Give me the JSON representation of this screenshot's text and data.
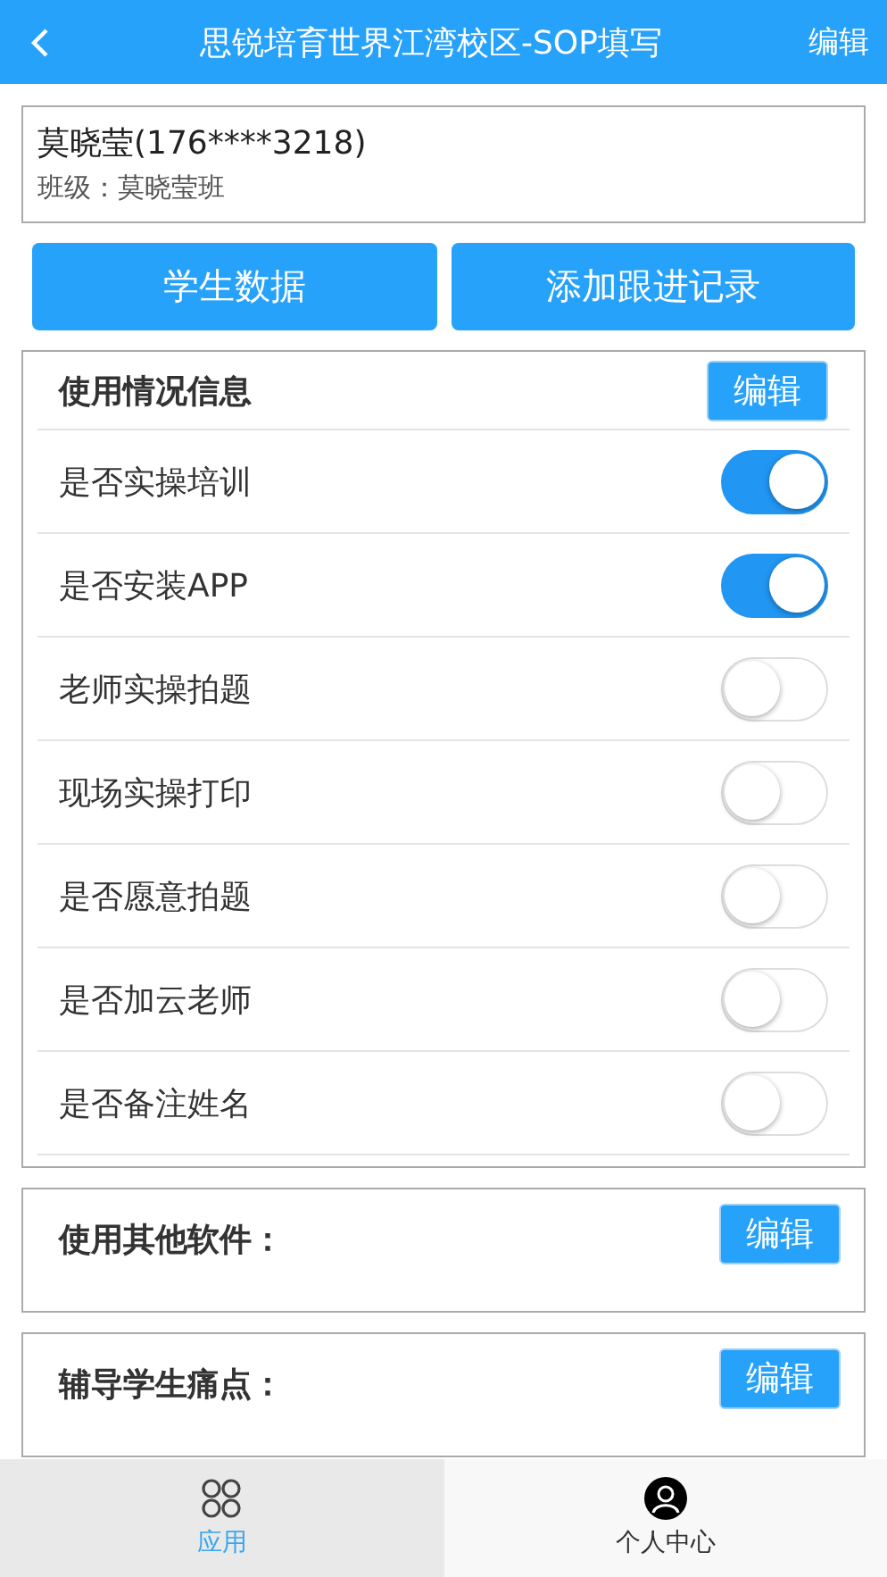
{
  "header": {
    "title": "思锐培育世界江湾校区-SOP填写",
    "action": "编辑"
  },
  "student": {
    "name": "莫晓莹(176****3218)",
    "class_line": "班级：莫晓莹班"
  },
  "action_buttons": [
    "学生数据",
    "添加跟进记录"
  ],
  "usage_panel": {
    "title": "使用情况信息",
    "edit_button": "编辑",
    "items": [
      {
        "label": "是否实操培训",
        "on": true
      },
      {
        "label": "是否安装APP",
        "on": true
      },
      {
        "label": "老师实操拍题",
        "on": false
      },
      {
        "label": "现场实操打印",
        "on": false
      },
      {
        "label": "是否愿意拍题",
        "on": false
      },
      {
        "label": "是否加云老师",
        "on": false
      },
      {
        "label": "是否备注姓名",
        "on": false
      }
    ]
  },
  "sections": [
    {
      "title": "使用其他软件：",
      "edit_button": "编辑"
    },
    {
      "title": "辅导学生痛点：",
      "edit_button": "编辑"
    }
  ],
  "tab_bar": [
    {
      "label": "应用",
      "kind": "apps",
      "selected": true
    },
    {
      "label": "个人中心",
      "kind": "person",
      "selected": false
    }
  ]
}
